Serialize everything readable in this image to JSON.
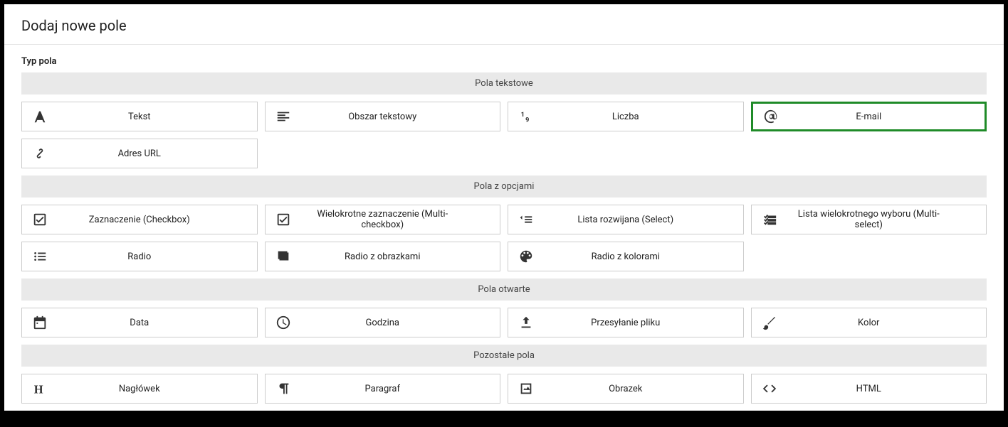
{
  "header": {
    "title": "Dodaj nowe pole"
  },
  "section_label": "Typ pola",
  "groups": {
    "text_fields": {
      "header": "Pola tekstowe"
    },
    "option_fields": {
      "header": "Pola z opcjami"
    },
    "open_fields": {
      "header": "Pola otwarte"
    },
    "other_fields": {
      "header": "Pozostałe pola"
    }
  },
  "tiles": {
    "tekst": "Tekst",
    "obszar": "Obszar tekstowy",
    "liczba": "Liczba",
    "email": "E-mail",
    "url": "Adres URL",
    "checkbox": "Zaznaczenie (Checkbox)",
    "multicheckbox": "Wielokrotne zaznaczenie (Multi-checkbox)",
    "select": "Lista rozwijana (Select)",
    "multiselect": "Lista wielokrotnego wyboru (Multi-select)",
    "radio": "Radio",
    "radio_img": "Radio z obrazkami",
    "radio_color": "Radio z kolorami",
    "data": "Data",
    "godzina": "Godzina",
    "file": "Przesyłanie pliku",
    "kolor": "Kolor",
    "naglowek": "Nagłówek",
    "paragraf": "Paragraf",
    "obrazek": "Obrazek",
    "html": "HTML"
  }
}
